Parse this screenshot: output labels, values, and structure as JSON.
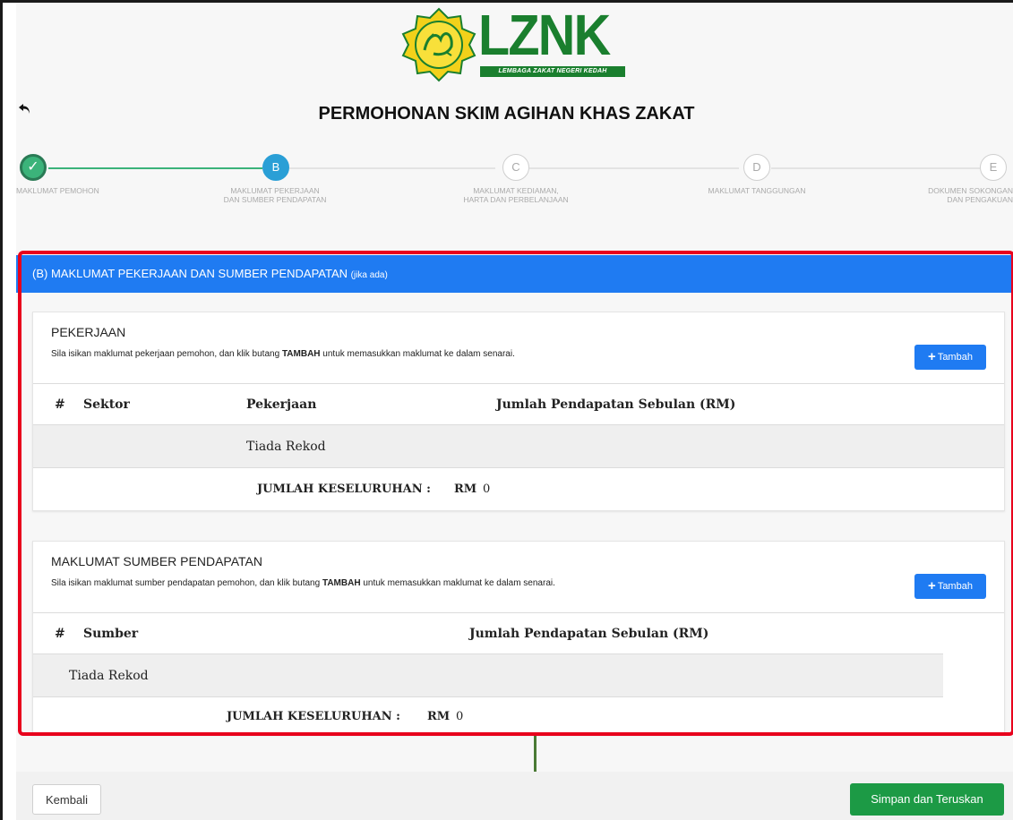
{
  "header": {
    "logo_text": "LZNK",
    "logo_subtitle": "LEMBAGA ZAKAT NEGERI KEDAH",
    "title": "PERMOHONAN SKIM AGIHAN KHAS ZAKAT",
    "back_icon": "undo-arrow-icon"
  },
  "stepper": {
    "steps": [
      {
        "marker": "✓",
        "label1": "MAKLUMAT PEMOHON",
        "label2": "",
        "state": "done"
      },
      {
        "marker": "B",
        "label1": "MAKLUMAT PEKERJAAN",
        "label2": "DAN SUMBER PENDAPATAN",
        "state": "active"
      },
      {
        "marker": "C",
        "label1": "MAKLUMAT KEDIAMAN,",
        "label2": "HARTA DAN PERBELANJAAN",
        "state": "pending"
      },
      {
        "marker": "D",
        "label1": "MAKLUMAT TANGGUNGAN",
        "label2": "",
        "state": "pending"
      },
      {
        "marker": "E",
        "label1": "DOKUMEN SOKONGAN",
        "label2": "DAN PENGAKUAN",
        "state": "pending"
      }
    ]
  },
  "section": {
    "title": "(B) MAKLUMAT PEKERJAAN DAN SUMBER PENDAPATAN",
    "note": "(jika ada)",
    "color": "#1f7bf2"
  },
  "pekerjaan": {
    "title": "PEKERJAAN",
    "desc_pre": "Sila isikan maklumat pekerjaan pemohon, dan klik butang ",
    "desc_bold": "TAMBAH",
    "desc_post": " untuk memasukkan maklumat ke dalam senarai.",
    "add_label": "Tambah",
    "columns": [
      "#",
      "Sektor",
      "Pekerjaan",
      "Jumlah Pendapatan Sebulan (RM)"
    ],
    "empty": "Tiada Rekod",
    "total_label": "JUMLAH KESELURUHAN :",
    "total_currency": "RM",
    "total_value": "0"
  },
  "sumber": {
    "title": "MAKLUMAT SUMBER PENDAPATAN",
    "desc_pre": "Sila isikan maklumat sumber pendapatan pemohon, dan klik butang ",
    "desc_bold": "TAMBAH",
    "desc_post": " untuk memasukkan maklumat ke dalam senarai.",
    "add_label": "Tambah",
    "columns": [
      "#",
      "Sumber",
      "Jumlah Pendapatan Sebulan (RM)"
    ],
    "empty": "Tiada Rekod",
    "total_label": "JUMLAH KESELURUHAN :",
    "total_currency": "RM",
    "total_value": "0"
  },
  "footer": {
    "back_label": "Kembali",
    "save_label": "Simpan dan Teruskan",
    "save_color": "#1c9a45"
  }
}
